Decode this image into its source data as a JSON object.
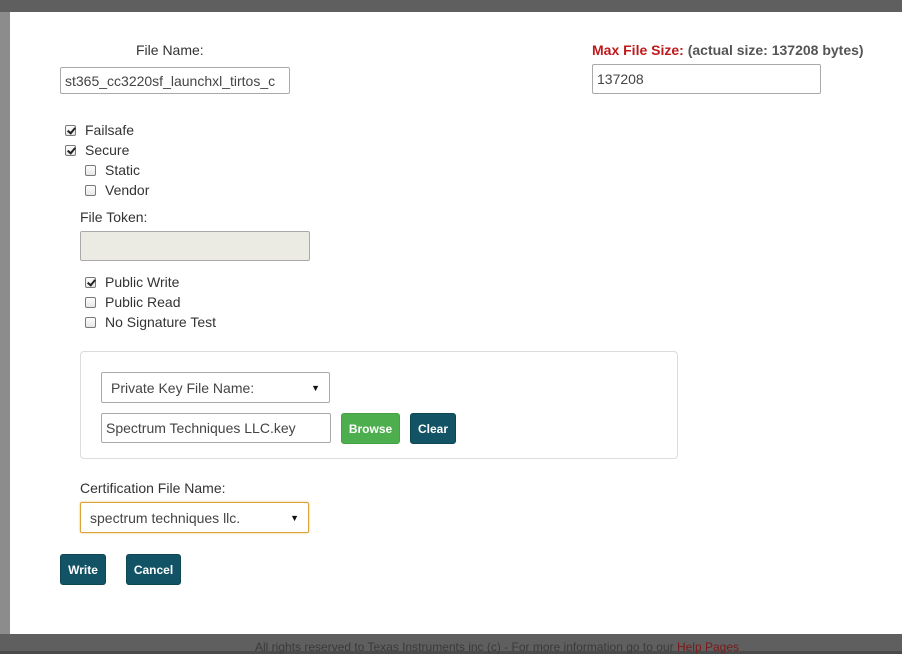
{
  "background": {
    "footer_text": "All rights reserved to Texas Instruments inc (c) - For more information go to our",
    "footer_link": "Help Pages"
  },
  "dialog": {
    "file_name_label": "File Name:",
    "file_name_value": "st365_cc3220sf_launchxl_tirtos_c",
    "max_size_label": "Max File Size:",
    "actual_size_text": "(actual size: 137208 bytes)",
    "max_size_value": "137208",
    "options": {
      "failsafe": {
        "label": "Failsafe",
        "checked": true
      },
      "secure": {
        "label": "Secure",
        "checked": true
      },
      "static": {
        "label": "Static",
        "checked": false
      },
      "vendor": {
        "label": "Vendor",
        "checked": false
      },
      "public_write": {
        "label": "Public Write",
        "checked": true
      },
      "public_read": {
        "label": "Public Read",
        "checked": false
      },
      "no_signature_test": {
        "label": "No Signature Test",
        "checked": false
      }
    },
    "file_token_label": "File Token:",
    "file_token_value": "",
    "key_select_value": "Private Key File Name:",
    "key_file_value": "Spectrum Techniques LLC.key",
    "browse_label": "Browse",
    "clear_label": "Clear",
    "cert_label": "Certification File Name:",
    "cert_select_value": "spectrum techniques llc.",
    "write_label": "Write",
    "cancel_label": "Cancel"
  },
  "colors": {
    "accent_red": "#c0191b",
    "button_green": "#4cae4c",
    "button_teal": "#125466"
  }
}
